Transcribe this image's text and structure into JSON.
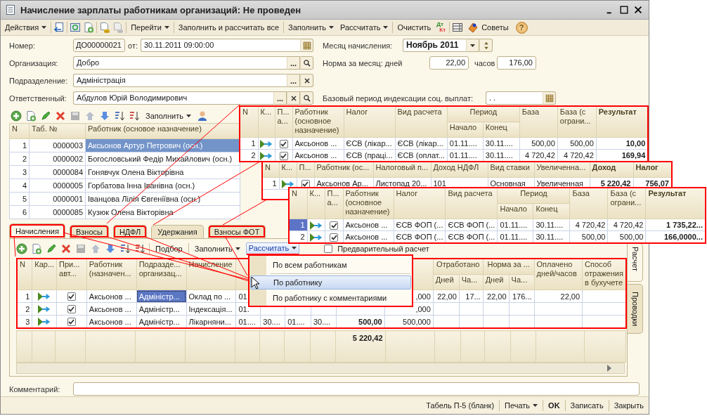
{
  "window": {
    "title": "Начисление зарплаты работникам организаций: Не проведен"
  },
  "toolbar": [
    {
      "kind": "menu",
      "label": "Действия"
    },
    {
      "kind": "menu",
      "label": "Перейти"
    },
    {
      "kind": "button",
      "label": "Заполнить и рассчитать все"
    },
    {
      "kind": "menu",
      "label": "Заполнить"
    },
    {
      "kind": "menu",
      "label": "Рассчитать"
    },
    {
      "kind": "button",
      "label": "Очистить"
    },
    {
      "kind": "debit-credit",
      "debit": "Дт",
      "credit": "Кт"
    },
    {
      "kind": "button",
      "label": "Советы"
    },
    {
      "kind": "help",
      "label": "?"
    }
  ],
  "form": {
    "number": {
      "label": "Номер:",
      "value": "ДО00000021"
    },
    "date": {
      "label": "от:",
      "value": "30.11.2011 09:00:00"
    },
    "organization": {
      "label": "Организация:",
      "value": "Добро",
      "select": "..."
    },
    "department": {
      "label": "Подразделение:",
      "value": "Адміністрація",
      "select": "..."
    },
    "responsible": {
      "label": "Ответственный:",
      "value": "Абдулов Юрій Володимирович",
      "select": "..."
    },
    "month": {
      "label": "Месяц начисления:",
      "value": "Ноябрь 2011"
    },
    "norm": {
      "label": "Норма за месяц: дней",
      "days": "22,00",
      "hours_label": "часов",
      "hours": "176,00"
    },
    "base_period": {
      "label": "Базовый период индексации соц. выплат:",
      "value": ". ."
    }
  },
  "employees": {
    "fill": "Заполнить",
    "columns": [
      "N",
      "Таб. №",
      "Работник (основое назначение)"
    ],
    "rows": [
      {
        "number": "1",
        "tab_number": "0000003",
        "name": "Аксьонов Артур Петрович (осн.)",
        "selected": true
      },
      {
        "number": "2",
        "tab_number": "0000002",
        "name": "Богословський Федір Михайлович (осн.)",
        "selected": false
      },
      {
        "number": "3",
        "tab_number": "0000084",
        "name": "Гонявчук Олена Вікторівна",
        "selected": false
      },
      {
        "number": "4",
        "tab_number": "0000005",
        "name": "Горбатова Інна Іванівна (осн.)",
        "selected": false
      },
      {
        "number": "5",
        "tab_number": "0000001",
        "name": "Іванцова Лілія Євгеніївна (осн.)",
        "selected": false
      },
      {
        "number": "6",
        "tab_number": "0000085",
        "name": "Кузюк Олена Вікторівна",
        "selected": false
      }
    ]
  },
  "tabs": [
    {
      "label": "Начисления",
      "selected": true,
      "highlighted": true
    },
    {
      "label": "Взносы",
      "selected": false,
      "highlighted": true
    },
    {
      "label": "НДФЛ",
      "selected": false,
      "highlighted": true
    },
    {
      "label": "Удержания",
      "selected": false,
      "highlighted": false
    },
    {
      "label": "Взносы ФОТ",
      "selected": false,
      "highlighted": true
    }
  ],
  "accruals_toolbar": {
    "pick": "Подбор",
    "fill": "Заполнить",
    "calculate": {
      "label": "Рассчитать",
      "pressed": true
    },
    "preliminary": {
      "label": "Предварительный расчет",
      "checked": false
    }
  },
  "accruals": {
    "columns": [
      {
        "label": "N"
      },
      {
        "label": "Кар..."
      },
      {
        "label": "При... авт..."
      },
      {
        "label": "Работник (назначен..."
      },
      {
        "label": "Подразде... организац..."
      },
      {
        "label": "Начисление"
      },
      {},
      {},
      {},
      {},
      {},
      {},
      {
        "label": "Отработано",
        "colspan": 2,
        "children": [
          {
            "label": "Дней"
          },
          {
            "label": "Ча..."
          }
        ]
      },
      {
        "label": "Норма за ...",
        "colspan": 2,
        "children": [
          {
            "label": "Дней"
          },
          {
            "label": "Ча..."
          }
        ]
      },
      {
        "label": "Оплачено дней/часов"
      },
      {
        "label": "Способ отражения в бухучете"
      }
    ],
    "rows": [
      {
        "cells": [
          "1",
          {
            "kind": "icon"
          },
          {
            "kind": "checkbox",
            "checked": true
          },
          "Аксьонов ...",
          {
            "text": "Адміністр...",
            "focused": true
          },
          "Оклад по ...",
          "01.",
          "",
          "",
          "",
          "",
          ",000",
          "22,00",
          "17...",
          "22,00",
          "176...",
          "22,00",
          ""
        ]
      },
      {
        "cells": [
          "2",
          {
            "kind": "icon"
          },
          {
            "kind": "checkbox",
            "checked": true
          },
          "Аксьонов ...",
          {
            "text": "Адміністр...",
            "focused": false
          },
          "Індексація...",
          "01.",
          "",
          "",
          "",
          "",
          ",000",
          "",
          "",
          "",
          "",
          "",
          ""
        ]
      },
      {
        "cells": [
          "3",
          {
            "kind": "icon"
          },
          {
            "kind": "checkbox",
            "checked": true
          },
          "Аксьонов ...",
          {
            "text": "Адміністр...",
            "focused": false
          },
          "Лікарняни...",
          "01....",
          "30....",
          "01....",
          "30....",
          "500,00",
          "500,000",
          "",
          "",
          "",
          "",
          "",
          ""
        ]
      }
    ],
    "totals": {
      "result": "5 220,42"
    }
  },
  "calc_menu": [
    {
      "kind": "item",
      "label": "По всем работникам",
      "selected": false
    },
    {
      "kind": "separator"
    },
    {
      "kind": "item",
      "label": "По работнику",
      "selected": true
    },
    {
      "kind": "item",
      "label": "По работнику с комментариями",
      "selected": false
    }
  ],
  "side_tabs": [
    {
      "label": "Расчет",
      "selected": true
    },
    {
      "label": "Проводки",
      "selected": false
    }
  ],
  "comment": {
    "label": "Комментарий:"
  },
  "footer": [
    {
      "kind": "button",
      "label": "Табель П-5 (бланк)"
    },
    {
      "kind": "menu",
      "label": "Печать"
    },
    {
      "kind": "default",
      "label": "OK"
    },
    {
      "kind": "button",
      "label": "Записать"
    },
    {
      "kind": "button",
      "label": "Закрыть"
    }
  ],
  "callouts": [
    {
      "columns": [
        {
          "label": "N"
        },
        {
          "label": "К..."
        },
        {
          "label": "П... а..."
        },
        {
          "label": "Работник (основное назначение)"
        },
        {
          "label": "Налог"
        },
        {
          "label": "Вид расчета"
        },
        {
          "label": "Период",
          "colspan": 2,
          "children": [
            {
              "label": "Начало"
            },
            {
              "label": "Конец"
            }
          ]
        },
        {
          "label": "База"
        },
        {
          "label": "База (с ограни..."
        },
        {
          "label": "Результат"
        }
      ],
      "rows": [
        {
          "selected": false,
          "cells": [
            "1",
            {
              "kind": "icon"
            },
            {
              "kind": "checkbox",
              "checked": true
            },
            "Аксьонов ...",
            "ЄСВ (лікар...",
            "ЄСВ (лікар...",
            "01.11....",
            "30.11....",
            "500,00",
            "500,00",
            "10,00"
          ]
        },
        {
          "selected": false,
          "cells": [
            "2",
            {
              "kind": "icon"
            },
            {
              "kind": "checkbox",
              "checked": true
            },
            "Аксьонов ...",
            "ЄСВ (праці...",
            "ЄСВ (оплат...",
            "01.11....",
            "30.11....",
            "4 720,42",
            "4 720,42",
            "169,94"
          ]
        }
      ]
    },
    {
      "columns": [
        {
          "label": "N"
        },
        {
          "label": "К..."
        },
        {
          "label": "П..."
        },
        {
          "label": "Работник (ос..."
        },
        {
          "label": "Налоговый п..."
        },
        {
          "label": "Доход НДФЛ"
        },
        {
          "label": "Вид ставки"
        },
        {
          "label": "Увеличенна..."
        },
        {
          "label": "Доход"
        },
        {
          "label": "Налог"
        }
      ],
      "rows": [
        {
          "selected": false,
          "cells": [
            "1",
            {
              "kind": "icon"
            },
            {
              "kind": "checkbox",
              "checked": true
            },
            "Аксьонов Ар...",
            "Листопад 20...",
            "101",
            "Основная",
            "Увеличенная",
            "5 220,42",
            "756,07"
          ]
        }
      ]
    },
    {
      "columns": [
        {
          "label": "N"
        },
        {
          "label": "К..."
        },
        {
          "label": "П... а..."
        },
        {
          "label": "Работник (основное назначение)"
        },
        {
          "label": "Налог"
        },
        {
          "label": "Вид расчета"
        },
        {
          "label": "Период",
          "colspan": 2,
          "children": [
            {
              "label": "Начало"
            },
            {
              "label": "Конец"
            }
          ]
        },
        {
          "label": "База"
        },
        {
          "label": "База (с ограни..."
        },
        {
          "label": "Результат"
        }
      ],
      "rows": [
        {
          "selected": true,
          "cells": [
            "1",
            {
              "kind": "icon"
            },
            {
              "kind": "checkbox",
              "checked": true
            },
            "Аксьонов ...",
            "ЄСВ ФОП (...",
            "ЄСВ ФОП (...",
            "01.11....",
            "30.11....",
            "4 720,42",
            "4 720,42",
            "1 735,22..."
          ]
        },
        {
          "selected": false,
          "cells": [
            "2",
            {
              "kind": "icon"
            },
            {
              "kind": "checkbox",
              "checked": true
            },
            "Аксьонов ...",
            "ЄСВ ФОП (...",
            "ЄСВ ФОП (...",
            "01.11....",
            "30.11....",
            "500,00",
            "500,00",
            "166,0000..."
          ]
        }
      ]
    }
  ]
}
